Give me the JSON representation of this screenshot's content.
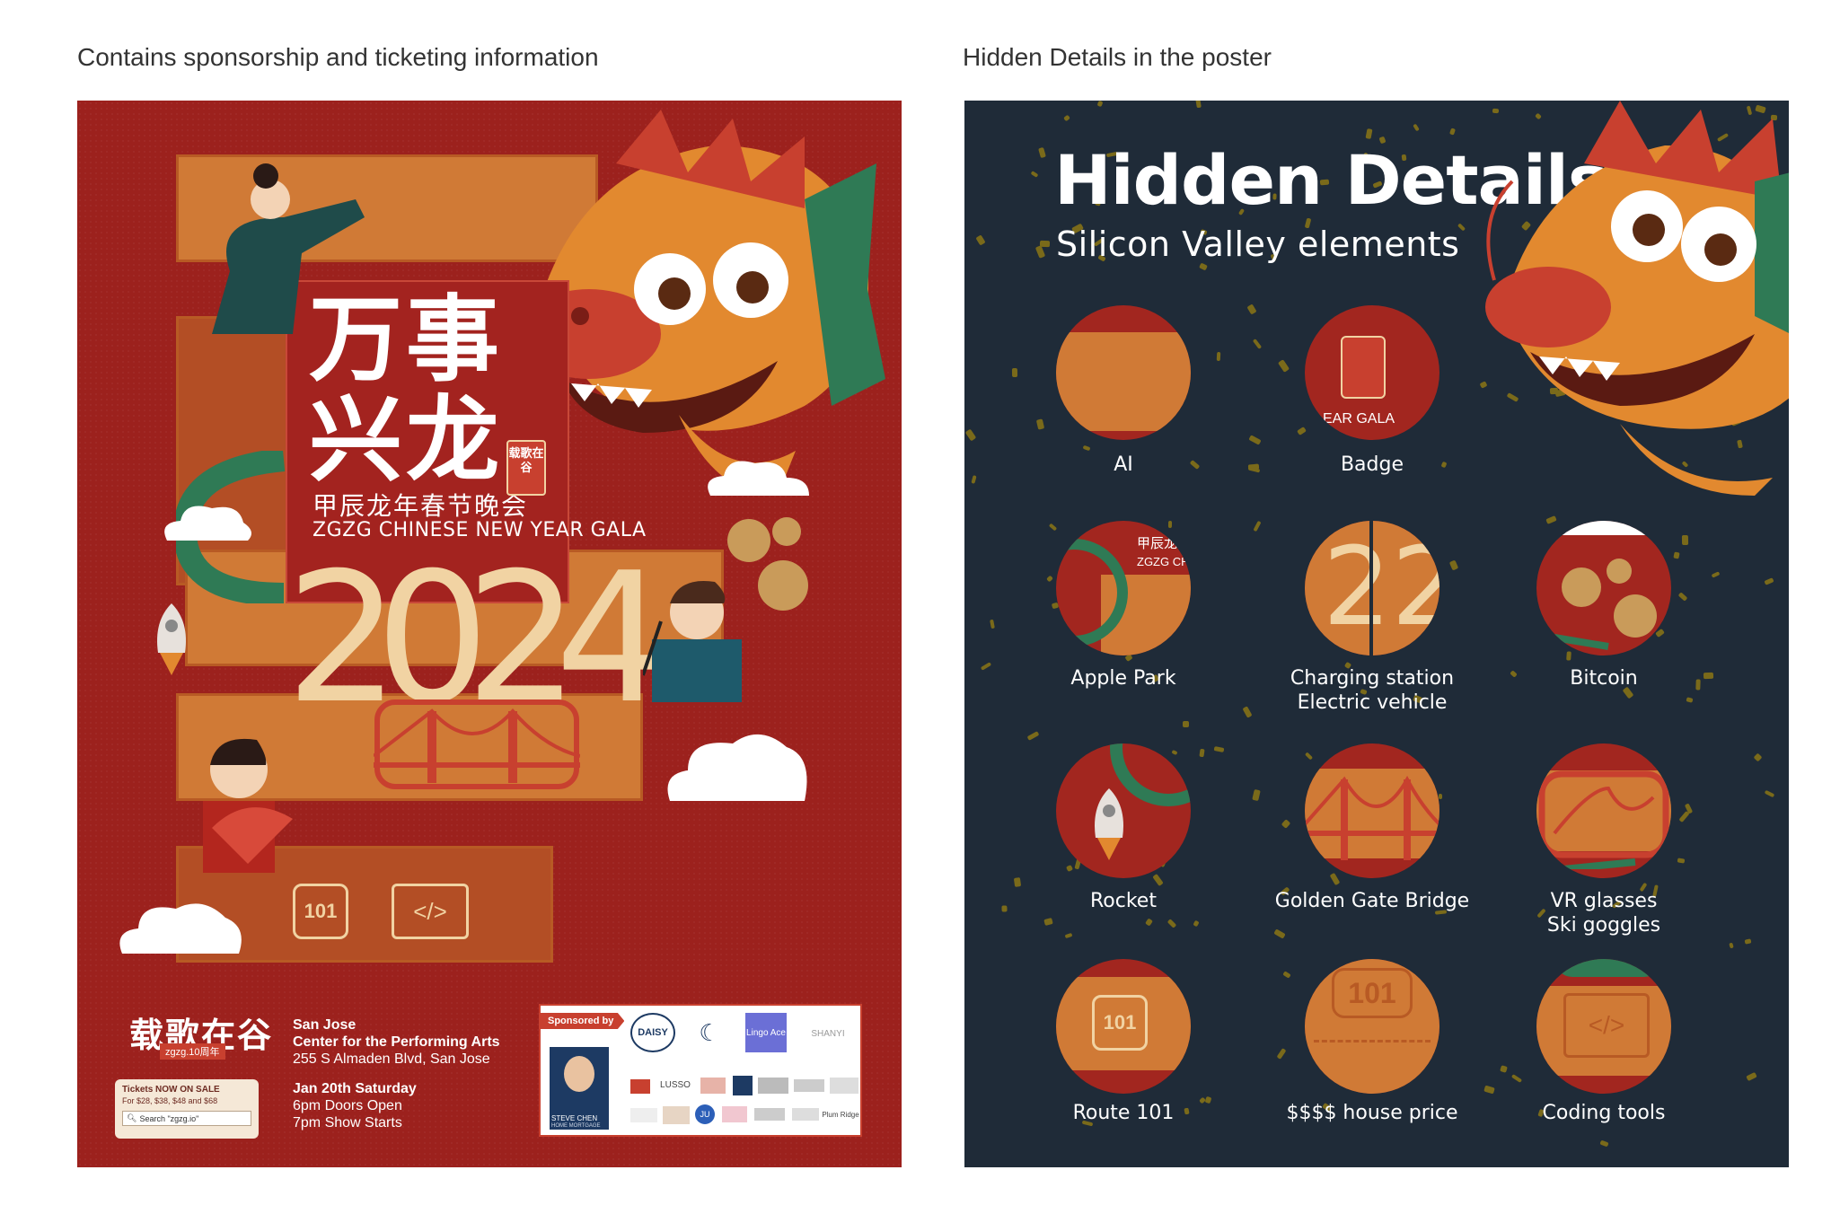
{
  "captions": {
    "left": "Contains sponsorship and ticketing information",
    "right": "Hidden Details in the poster"
  },
  "poster_left": {
    "title_line1": "万事",
    "title_line2": "兴龙",
    "subtitle_cn": "甲辰龙年春节晚会",
    "subtitle_en": "ZGZG CHINESE NEW YEAR GALA",
    "year_digits": [
      "2",
      "0",
      "2",
      "4"
    ],
    "seal_text": "载歌在谷",
    "logo_text": "载歌在谷",
    "logo_sub": "zgzg.10周年",
    "route_sign": "101",
    "code_sign": "</>",
    "venue": {
      "city": "San Jose",
      "name": "Center for the Performing Arts",
      "address": "255 S Almaden Blvd, San Jose",
      "date": "Jan 20th Saturday",
      "doors": "6pm Doors Open",
      "show": "7pm Show Starts"
    },
    "ticket": {
      "headline": "Tickets NOW ON SALE",
      "prices": "For $28, $38, $48 and $68",
      "search": "Search \"zgzg.io\""
    },
    "sponsor": {
      "tag": "Sponsored by",
      "person_name": "STEVE CHEN",
      "person_title": "HOME MORTGAGE",
      "logos": [
        "DAISY",
        "Lingo Ace",
        "SHANYI",
        "LUSSO",
        "JU",
        "Plum Ridge"
      ]
    }
  },
  "poster_right": {
    "title": "Hidden Details",
    "subtitle": "Silicon Valley elements",
    "badge_fragment": "EAR GALA",
    "apple_fragment_1": "甲辰龙",
    "apple_fragment_2": "ZGZG CH",
    "items": [
      {
        "label": "AI"
      },
      {
        "label": "Badge"
      },
      {
        "label": "Apple Park"
      },
      {
        "label": "Charging station\nElectric vehicle"
      },
      {
        "label": "Bitcoin"
      },
      {
        "label": "Rocket"
      },
      {
        "label": "Golden Gate Bridge"
      },
      {
        "label": "VR glasses\nSki goggles"
      },
      {
        "label": "Route 101"
      },
      {
        "label": "$$$$ house price"
      },
      {
        "label": "Coding tools"
      }
    ]
  },
  "colors": {
    "left_bg": "#9c211d",
    "right_bg": "#1f2b38",
    "band_orange": "#d07a36",
    "accent_red": "#c8402f",
    "cream": "#f1d3a3",
    "green": "#2f7a55"
  }
}
